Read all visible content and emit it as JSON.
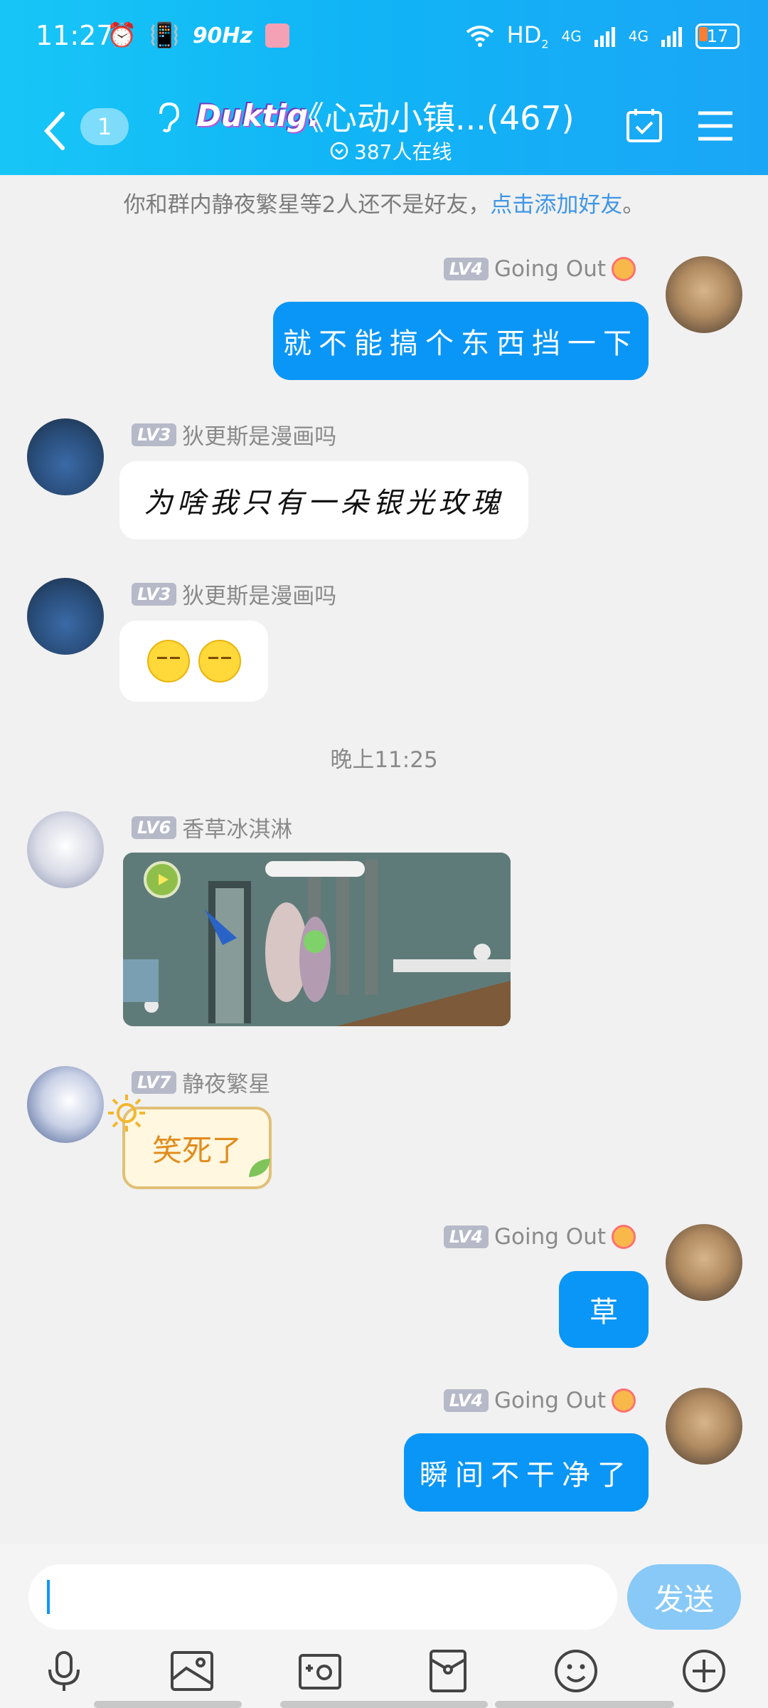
{
  "status_bar": {
    "time": "11:27",
    "refresh": "90Hz",
    "network_hd": "HD",
    "network_hd_sub": "2",
    "network_4g_1": "4G",
    "network_4g_2": "4G",
    "battery": "17"
  },
  "header": {
    "back_icon": "chevron-left-icon",
    "unread_count": "1",
    "group_logo_text": "Duktig.",
    "title": "《心动小镇...(467)",
    "online_count": "387人在线"
  },
  "notice": {
    "text": "你和群内静夜繁星等2人还不是好友，",
    "link": "点击添加好友",
    "end": "。"
  },
  "messages": [
    {
      "side": "right",
      "level": "LV4",
      "name": "Going Out",
      "text": "就不能搞个东西挡一下"
    },
    {
      "side": "left",
      "level": "LV3",
      "name": "狄更斯是漫画吗",
      "text": "为啥我只有一朵银光玫瑰"
    },
    {
      "side": "left",
      "level": "LV3",
      "name": "狄更斯是漫画吗",
      "text": ""
    },
    {
      "side": "left",
      "level": "LV6",
      "name": "香草冰淇淋",
      "text": ""
    },
    {
      "side": "left",
      "level": "LV7",
      "name": "静夜繁星",
      "text": "笑死了"
    },
    {
      "side": "right",
      "level": "LV4",
      "name": "Going Out",
      "text": "草"
    },
    {
      "side": "right",
      "level": "LV4",
      "name": "Going Out",
      "text": "瞬间不干净了"
    }
  ],
  "time_separator": "晚上11:25",
  "composer": {
    "send_label": "发送"
  },
  "colors": {
    "header_start": "#17c6f7",
    "header_end": "#1aa6f6",
    "my_bubble": "#0a96f6",
    "link": "#3f96e6"
  }
}
